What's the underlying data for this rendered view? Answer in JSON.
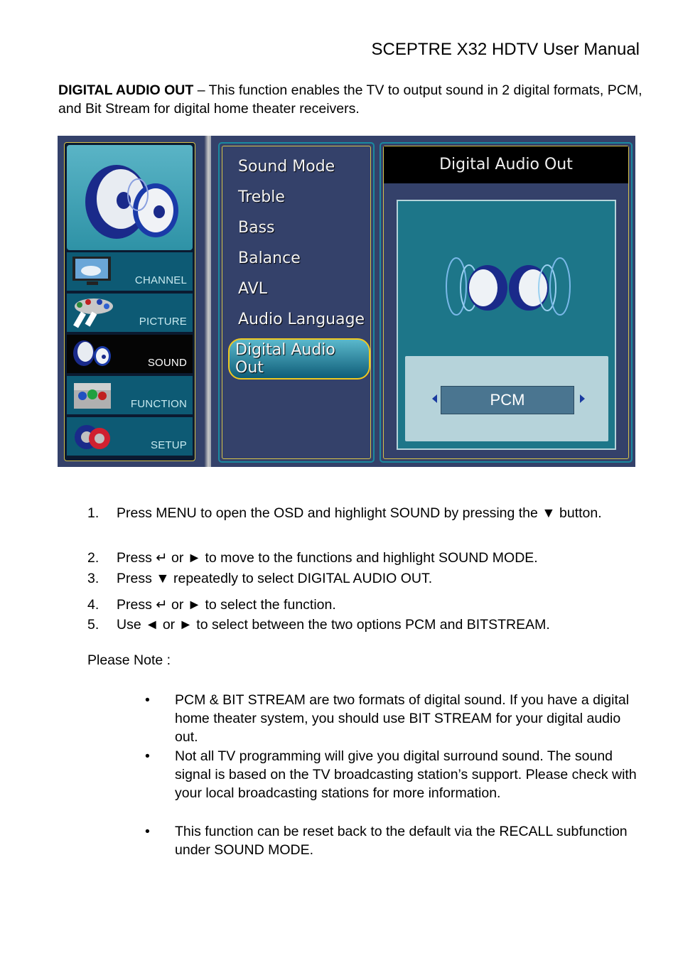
{
  "header": {
    "title": "SCEPTRE X32 HDTV User Manual"
  },
  "intro": {
    "term": "DIGITAL AUDIO OUT",
    "description": " – This function enables the TV to output sound in 2 digital formats, PCM, and Bit Stream for digital home theater receivers."
  },
  "osd": {
    "categories": [
      {
        "label": "CHANNEL",
        "icon": "tv-icon",
        "active": false
      },
      {
        "label": "PICTURE",
        "icon": "paint-palette-icon",
        "active": false
      },
      {
        "label": "SOUND",
        "icon": "speaker-icon",
        "active": true
      },
      {
        "label": "FUNCTION",
        "icon": "toolbox-icon",
        "active": false
      },
      {
        "label": "SETUP",
        "icon": "gears-icon",
        "active": false
      }
    ],
    "menu_items": [
      {
        "label": "Sound Mode"
      },
      {
        "label": "Treble"
      },
      {
        "label": "Bass"
      },
      {
        "label": "Balance"
      },
      {
        "label": "AVL"
      },
      {
        "label": "Audio Language"
      },
      {
        "label": "Digital Audio Out",
        "selected": true
      }
    ],
    "panel_title": "Digital Audio Out",
    "current_value": "PCM",
    "colors": {
      "frame": "#34416a",
      "accent_border": "#d6c24a",
      "teal": "#1d7689",
      "highlight": "#f0c820"
    }
  },
  "steps": [
    {
      "num": "1.",
      "text": "Press MENU to open the OSD and highlight SOUND by pressing the ▼ button."
    },
    {
      "num": "2.",
      "text": "Press ↵ or ► to move to the functions and highlight SOUND MODE."
    },
    {
      "num": "3.",
      "text": "Press ▼ repeatedly to select DIGITAL AUDIO OUT."
    },
    {
      "num": "4.",
      "text": "Press ↵ or ► to select the function."
    },
    {
      "num": "5.",
      "text": "Use ◄ or ► to select between the two options PCM and BITSTREAM."
    }
  ],
  "note": {
    "label": "Please Note :",
    "bullets": [
      "PCM & BIT STREAM are two formats of digital sound.  If you have a digital home theater system, you should use BIT STREAM for your digital audio out.",
      "Not all TV programming will give you digital surround sound.  The sound signal is based on the TV broadcasting station’s support.  Please check with your local broadcasting stations for more information.",
      "This function can be reset back to the default via the RECALL subfunction under SOUND MODE."
    ],
    "bullet_glyph": "•"
  }
}
